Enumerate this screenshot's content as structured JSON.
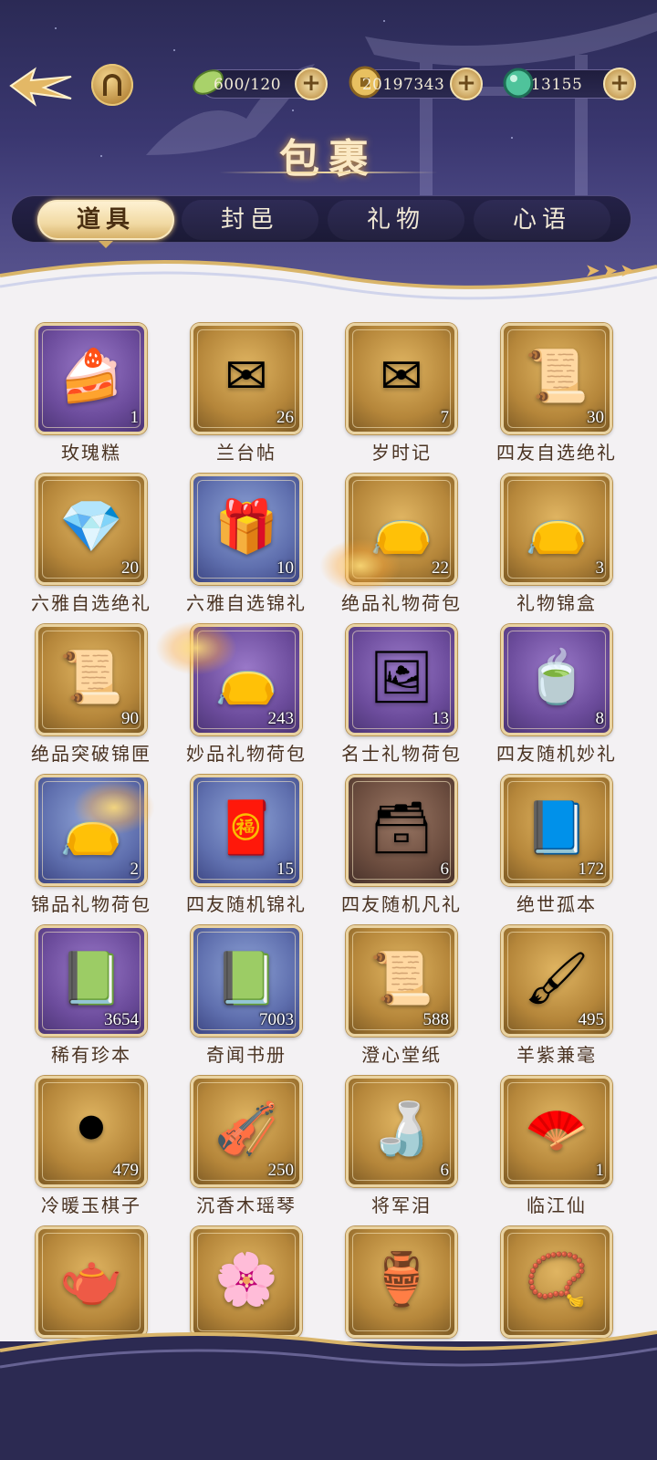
{
  "resources": [
    {
      "icon": "leaf-stamina-icon",
      "value": "600/120"
    },
    {
      "icon": "gold-coin-icon",
      "value": "20197343"
    },
    {
      "icon": "jade-gem-icon",
      "value": "13155"
    }
  ],
  "resource_add_symbol": "+",
  "page_title": "包裹",
  "tabs": [
    {
      "label": "道具",
      "active": true
    },
    {
      "label": "封邑",
      "active": false
    },
    {
      "label": "礼物",
      "active": false
    },
    {
      "label": "心语",
      "active": false
    }
  ],
  "items": [
    {
      "name": "玫瑰糕",
      "count": "1",
      "rarity": "purple",
      "icon": "rose-cake-icon"
    },
    {
      "name": "兰台帖",
      "count": "26",
      "rarity": "gold",
      "icon": "letter-scroll-icon"
    },
    {
      "name": "岁时记",
      "count": "7",
      "rarity": "gold",
      "icon": "green-letter-icon"
    },
    {
      "name": "四友自选绝礼",
      "count": "30",
      "rarity": "gold",
      "icon": "scroll-chest-icon"
    },
    {
      "name": "六雅自选绝礼",
      "count": "20",
      "rarity": "gold",
      "icon": "jewel-box-icon"
    },
    {
      "name": "六雅自选锦礼",
      "count": "10",
      "rarity": "blue",
      "icon": "flower-gift-box-icon"
    },
    {
      "name": "绝品礼物荷包",
      "count": "22",
      "rarity": "gold",
      "icon": "gift-pouch-icon"
    },
    {
      "name": "礼物锦盒",
      "count": "3",
      "rarity": "gold",
      "icon": "gift-pouch-icon"
    },
    {
      "name": "绝品突破锦匣",
      "count": "90",
      "rarity": "gold",
      "icon": "scroll-chest-icon"
    },
    {
      "name": "妙品礼物荷包",
      "count": "243",
      "rarity": "purple",
      "icon": "gift-pouch-icon"
    },
    {
      "name": "名士礼物荷包",
      "count": "13",
      "rarity": "purple",
      "icon": "painting-gift-icon"
    },
    {
      "name": "四友随机妙礼",
      "count": "8",
      "rarity": "purple",
      "icon": "tea-chest-icon"
    },
    {
      "name": "锦品礼物荷包",
      "count": "2",
      "rarity": "blue",
      "icon": "gift-pouch-icon"
    },
    {
      "name": "四友随机锦礼",
      "count": "15",
      "rarity": "blue",
      "icon": "red-chest-icon"
    },
    {
      "name": "四友随机凡礼",
      "count": "6",
      "rarity": "brown",
      "icon": "blue-chest-icon"
    },
    {
      "name": "绝世孤本",
      "count": "172",
      "rarity": "gold",
      "icon": "rare-book-icon"
    },
    {
      "name": "稀有珍本",
      "count": "3654",
      "rarity": "purple",
      "icon": "green-book-icon"
    },
    {
      "name": "奇闻书册",
      "count": "7003",
      "rarity": "blue",
      "icon": "book-leaf-icon"
    },
    {
      "name": "澄心堂纸",
      "count": "588",
      "rarity": "gold",
      "icon": "paper-scroll-icon"
    },
    {
      "name": "羊紫兼毫",
      "count": "495",
      "rarity": "gold",
      "icon": "brush-icon"
    },
    {
      "name": "冷暖玉棋子",
      "count": "479",
      "rarity": "gold",
      "icon": "go-board-icon"
    },
    {
      "name": "沉香木瑶琴",
      "count": "250",
      "rarity": "gold",
      "icon": "zither-icon"
    },
    {
      "name": "将军泪",
      "count": "6",
      "rarity": "gold",
      "icon": "wine-bottle-icon"
    },
    {
      "name": "临江仙",
      "count": "1",
      "rarity": "gold",
      "icon": "round-fan-icon"
    },
    {
      "name": "",
      "count": "",
      "rarity": "gold",
      "icon": "tea-set-icon"
    },
    {
      "name": "",
      "count": "",
      "rarity": "gold",
      "icon": "peony-icon"
    },
    {
      "name": "",
      "count": "",
      "rarity": "gold",
      "icon": "incense-burner-icon"
    },
    {
      "name": "",
      "count": "",
      "rarity": "gold",
      "icon": "necklace-chest-icon"
    }
  ],
  "glyphs": {
    "rose-cake-icon": "🍰",
    "letter-scroll-icon": "✉",
    "green-letter-icon": "✉",
    "scroll-chest-icon": "📜",
    "jewel-box-icon": "💎",
    "flower-gift-box-icon": "🎁",
    "gift-pouch-icon": "👝",
    "painting-gift-icon": "🖼",
    "tea-chest-icon": "🍵",
    "red-chest-icon": "🧧",
    "blue-chest-icon": "🗃",
    "rare-book-icon": "📘",
    "green-book-icon": "📗",
    "book-leaf-icon": "📗",
    "paper-scroll-icon": "📜",
    "brush-icon": "🖌",
    "go-board-icon": "⚫",
    "zither-icon": "🎻",
    "wine-bottle-icon": "🍶",
    "round-fan-icon": "🪭",
    "tea-set-icon": "🫖",
    "peony-icon": "🌸",
    "incense-burner-icon": "🏺",
    "necklace-chest-icon": "📿"
  },
  "colors": {
    "header_bg": "#3a3770",
    "tab_active": "#f1d9a3",
    "panel_bg": "#f3f1f3",
    "item_name": "#4a3322"
  }
}
